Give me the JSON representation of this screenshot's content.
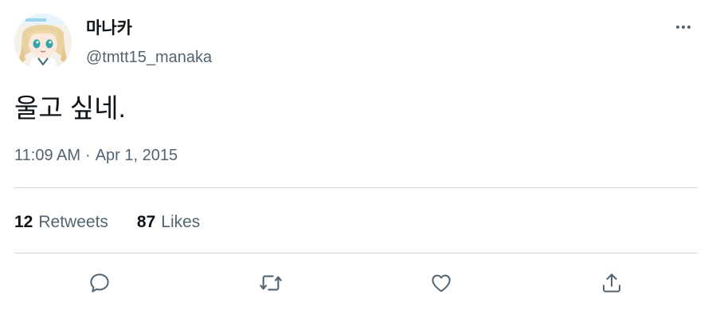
{
  "tweet": {
    "display_name": "마나카",
    "handle": "@tmtt15_manaka",
    "text": "울고 싶네.",
    "time": "11:09 AM",
    "separator": "·",
    "date": "Apr 1, 2015"
  },
  "stats": {
    "retweets_count": "12",
    "retweets_label": "Retweets",
    "likes_count": "87",
    "likes_label": "Likes"
  },
  "actions": [
    "reply-icon",
    "retweet-icon",
    "like-icon",
    "share-icon"
  ],
  "colors": {
    "text_primary": "#0f1419",
    "text_secondary": "#536471",
    "divider": "#cfd9de",
    "icon": "#536471"
  }
}
